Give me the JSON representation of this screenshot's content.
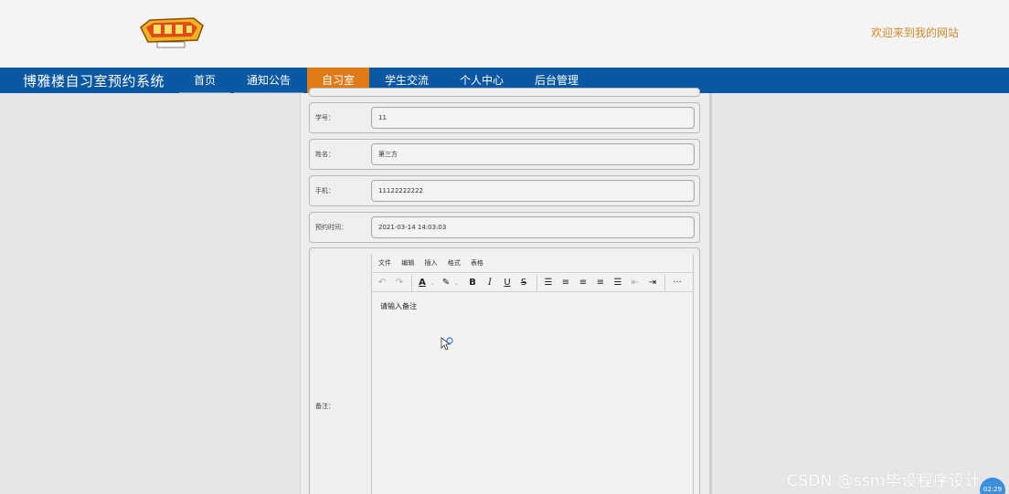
{
  "header": {
    "welcome_text": "欢迎来到我的网站"
  },
  "nav": {
    "site_title": "博雅楼自习室预约系统",
    "items": [
      {
        "label": "首页",
        "active": false
      },
      {
        "label": "通知公告",
        "active": false
      },
      {
        "label": "自习室",
        "active": true
      },
      {
        "label": "学生交流",
        "active": false
      },
      {
        "label": "个人中心",
        "active": false
      },
      {
        "label": "后台管理",
        "active": false
      }
    ]
  },
  "form": {
    "fields": [
      {
        "label": "学号：",
        "value": "11"
      },
      {
        "label": "姓名：",
        "value": "第三方"
      },
      {
        "label": "手机：",
        "value": "11122222222"
      },
      {
        "label": "预约时间：",
        "value": "2021-03-14 14:03:03"
      }
    ],
    "remark": {
      "label": "备注：",
      "editor_menu": [
        "文件",
        "编辑",
        "插入",
        "格式",
        "表格"
      ],
      "toolbar_icons": [
        "undo-icon",
        "redo-icon",
        "text-color-icon",
        "highlight-icon",
        "bold-icon",
        "italic-icon",
        "underline-icon",
        "strikethrough-icon",
        "list-icon",
        "align-left-icon",
        "align-center-icon",
        "align-right-icon",
        "justify-icon",
        "outdent-icon",
        "indent-icon",
        "more-icon"
      ],
      "placeholder": "请输入备注"
    }
  },
  "watermark": "CSDN @ssm毕设程序设计",
  "clock": "02:29",
  "colors": {
    "nav_bg": "#0a57a3",
    "active_tab": "#e07a17",
    "welcome": "#d18a2c"
  }
}
